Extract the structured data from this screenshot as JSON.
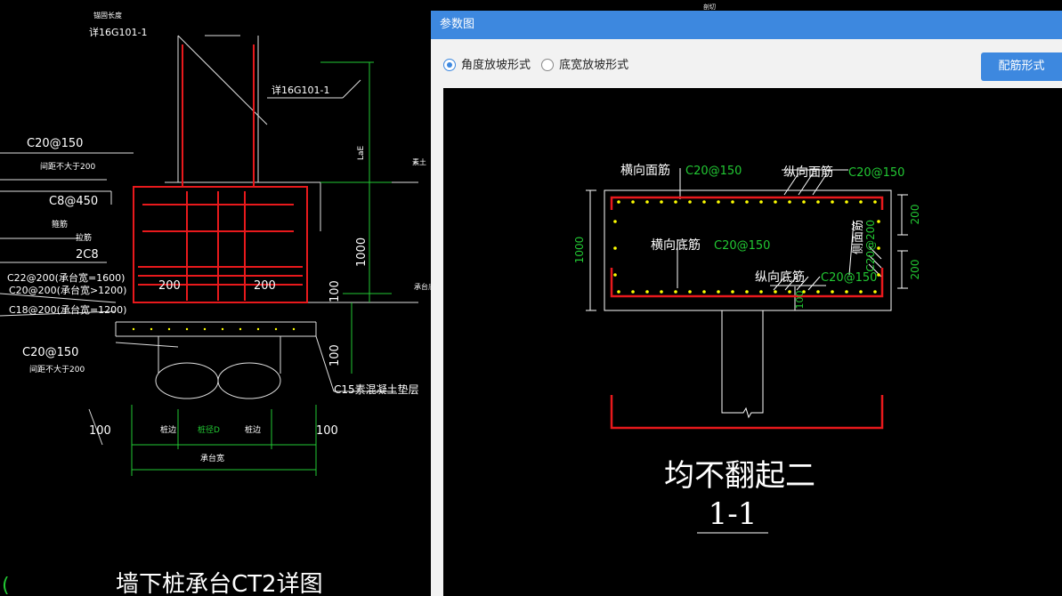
{
  "dialog": {
    "title": "参数图",
    "options": [
      {
        "label": "角度放坡形式",
        "checked": true
      },
      {
        "label": "底宽放坡形式",
        "checked": false
      }
    ],
    "rebar_form_button": "配筋形式"
  },
  "section_diagram": {
    "labels": {
      "transverse_top": "横向面筋",
      "transverse_top_spec": "C20@150",
      "longitudinal_top": "纵向面筋",
      "longitudinal_top_spec": "C20@150",
      "transverse_bottom": "横向底筋",
      "transverse_bottom_spec": "C20@150",
      "longitudinal_bottom": "纵向底筋",
      "longitudinal_bottom_spec": "C20@150",
      "side_rebar": "侧面筋",
      "side_rebar_spec": "C20@200",
      "height_1000": "1000",
      "dim_200_top": "200",
      "dim_200_bottom": "200",
      "dim_100": "100",
      "caption": "均不翻起二",
      "section_mark": "1-1"
    }
  },
  "background_cad": {
    "texts": {
      "anchor_note": "锚固长度",
      "ref_top": "详16G101-1",
      "ref_right": "详16G101-1",
      "dim_laE": "LaE",
      "spec_c20_150": "C20@150",
      "spec_c20_150_note": "间距不大于200",
      "spec_c8_450": "C8@450",
      "spec_c8_note": "箍筋",
      "spec_2c8_label": "拉筋",
      "spec_2c8": "2C8",
      "spec_c22": "C22@200(承台宽=1600)",
      "spec_c20": "C20@200(承台宽>1200)",
      "spec_c18": "C18@200(承台宽=1200)",
      "spec_c20_150_b": "C20@150",
      "spec_c20_150_b_note": "间距不大于200",
      "dim_200_left": "200",
      "dim_200_right": "200",
      "dim_1000": "1000",
      "dim_100_a": "100",
      "dim_100_b": "100",
      "c15_note": "C15素混凝土垫层",
      "dim_100_left": "100",
      "dim_100_right": "100",
      "dim_edge_l": "桩边",
      "dim_mid": "桩径D",
      "dim_edge_r": "桩边",
      "dim_width": "承台宽",
      "top_mark": "素土",
      "bottom_mark": "承台底",
      "cut_top": "剖切",
      "drawing_title": "墙下桩承台CT2详图",
      "left_mark": "("
    }
  },
  "colors": {
    "dialog_title_bg": "#3d88df",
    "cad_bg": "#000000",
    "cad_red": "#e8191c",
    "cad_green": "#22c833",
    "cad_yellow": "#ffff00",
    "cad_white": "#ffffff"
  }
}
